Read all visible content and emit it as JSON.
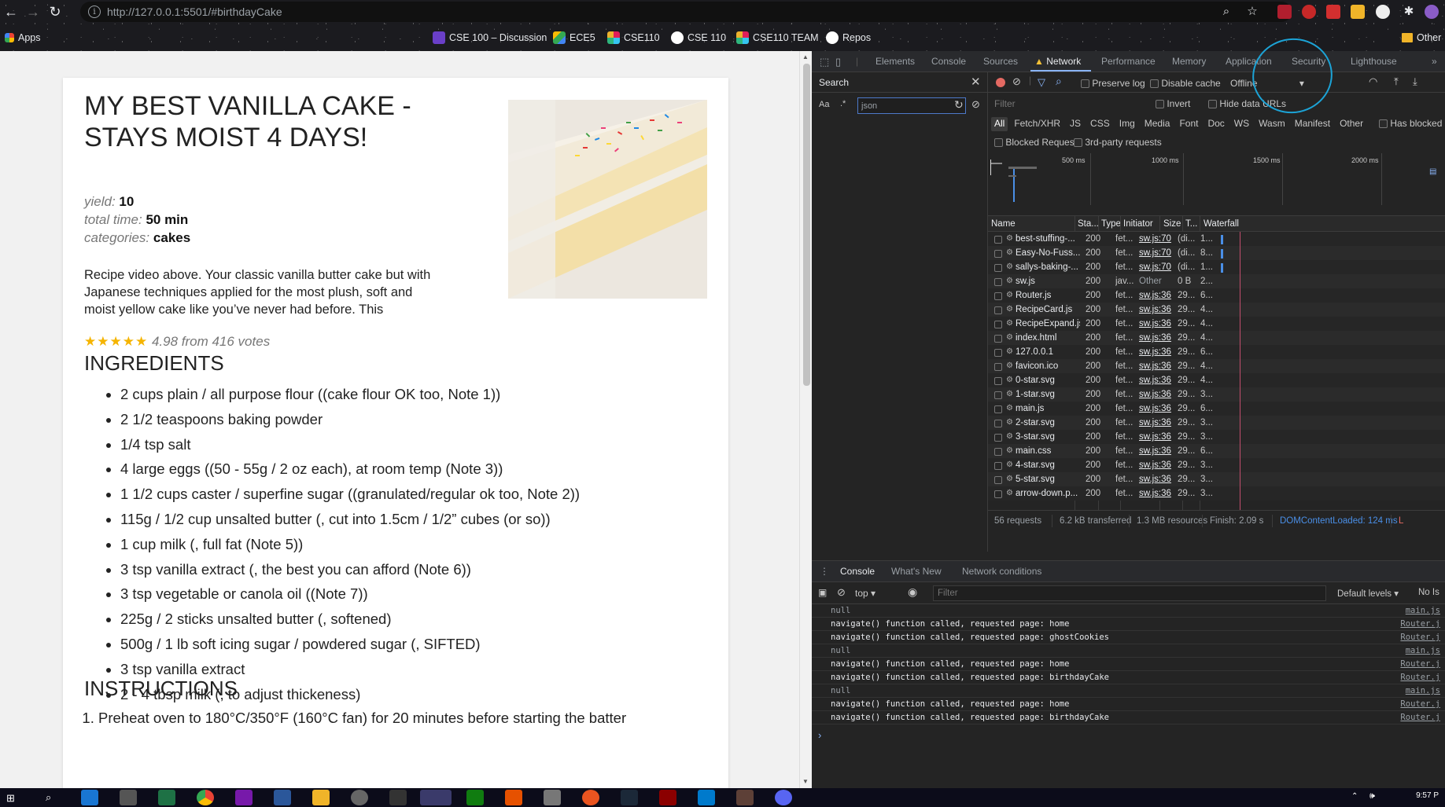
{
  "browser": {
    "url": "http://127.0.0.1:5501/#birthdayCake",
    "bookmarks": [
      "Apps",
      "CSE 100 – Discussion",
      "ECE5",
      "CSE110",
      "CSE 110",
      "CSE110 TEAM",
      "Repos",
      "Other"
    ]
  },
  "recipe": {
    "title": "MY BEST VANILLA CAKE - STAYS MOIST 4 DAYS!",
    "yield_label": "yield:",
    "yield_value": "10",
    "total_time_label": "total time:",
    "total_time_value": "50 min",
    "categories_label": "categories:",
    "categories_value": "cakes",
    "description": "Recipe video above. Your classic vanilla butter cake but with Japanese techniques applied for the most plush, soft and moist yellow cake like you’ve never had before. This",
    "stars": "★★★★★",
    "rating_text": "4.98 from 416 votes",
    "ingredients_title": "INGREDIENTS",
    "ingredients": [
      "2 cups plain / all purpose flour ((cake flour OK too, Note 1))",
      "2 1/2 teaspoons baking powder",
      "1/4 tsp salt",
      "4 large eggs ((50 - 55g / 2 oz each), at room temp (Note 3))",
      "1 1/2 cups caster / superfine sugar ((granulated/regular ok too, Note 2))",
      "115g / 1/2 cup unsalted butter (, cut into 1.5cm / 1/2” cubes (or so))",
      "1 cup milk (, full fat (Note 5))",
      "3 tsp vanilla extract (, the best you can afford (Note 6))",
      "3 tsp vegetable or canola oil ((Note 7))",
      "225g / 2 sticks unsalted butter (, softened)",
      "500g / 1 lb soft icing sugar / powdered sugar (, SIFTED)",
      "3 tsp vanilla extract",
      "2 - 4 tbsp milk (, to adjust thickeness)"
    ],
    "instructions_title": "INSTRUCTIONS",
    "first_instruction": "Preheat oven to 180°C/350°F (160°C fan) for 20 minutes before starting the batter"
  },
  "devtools": {
    "tabs": [
      "Elements",
      "Console",
      "Sources",
      "Network",
      "Performance",
      "Memory",
      "Application",
      "Security",
      "Lighthouse"
    ],
    "active_tab": "Network",
    "search_label": "Search",
    "search_value": "json",
    "search_case": "Aa",
    "search_regex": ".*",
    "preserve_log": "Preserve log",
    "disable_cache": "Disable cache",
    "throttling": "Offline",
    "filter_placeholder": "Filter",
    "invert": "Invert",
    "hide_data_urls": "Hide data URLs",
    "type_filters": [
      "All",
      "Fetch/XHR",
      "JS",
      "CSS",
      "Img",
      "Media",
      "Font",
      "Doc",
      "WS",
      "Wasm",
      "Manifest",
      "Other"
    ],
    "has_blocked_cookies": "Has blocked cookies",
    "blocked_requests": "Blocked Requests",
    "third_party": "3rd-party requests",
    "timeline_ticks": [
      "500 ms",
      "1000 ms",
      "1500 ms",
      "2000 ms"
    ],
    "columns": [
      "Name",
      "Sta...",
      "Type",
      "Initiator",
      "Size",
      "T...",
      "Waterfall"
    ],
    "requests": [
      {
        "name": "best-stuffing-...",
        "status": "200",
        "type": "fet...",
        "initiator": "sw.js:70",
        "size": "(di...",
        "time": "1..."
      },
      {
        "name": "Easy-No-Fuss...",
        "status": "200",
        "type": "fet...",
        "initiator": "sw.js:70",
        "size": "(di...",
        "time": "8..."
      },
      {
        "name": "sallys-baking-...",
        "status": "200",
        "type": "fet...",
        "initiator": "sw.js:70",
        "size": "(di...",
        "time": "1..."
      },
      {
        "name": "sw.js",
        "status": "200",
        "type": "jav...",
        "initiator": "Other",
        "size": "0 B",
        "time": "2..."
      },
      {
        "name": "Router.js",
        "status": "200",
        "type": "fet...",
        "initiator": "sw.js:36",
        "size": "29...",
        "time": "6..."
      },
      {
        "name": "RecipeCard.js",
        "status": "200",
        "type": "fet...",
        "initiator": "sw.js:36",
        "size": "29...",
        "time": "4..."
      },
      {
        "name": "RecipeExpand.js",
        "status": "200",
        "type": "fet...",
        "initiator": "sw.js:36",
        "size": "29...",
        "time": "4..."
      },
      {
        "name": "index.html",
        "status": "200",
        "type": "fet...",
        "initiator": "sw.js:36",
        "size": "29...",
        "time": "4..."
      },
      {
        "name": "127.0.0.1",
        "status": "200",
        "type": "fet...",
        "initiator": "sw.js:36",
        "size": "29...",
        "time": "6..."
      },
      {
        "name": "favicon.ico",
        "status": "200",
        "type": "fet...",
        "initiator": "sw.js:36",
        "size": "29...",
        "time": "4..."
      },
      {
        "name": "0-star.svg",
        "status": "200",
        "type": "fet...",
        "initiator": "sw.js:36",
        "size": "29...",
        "time": "4..."
      },
      {
        "name": "1-star.svg",
        "status": "200",
        "type": "fet...",
        "initiator": "sw.js:36",
        "size": "29...",
        "time": "3..."
      },
      {
        "name": "main.js",
        "status": "200",
        "type": "fet...",
        "initiator": "sw.js:36",
        "size": "29...",
        "time": "6..."
      },
      {
        "name": "2-star.svg",
        "status": "200",
        "type": "fet...",
        "initiator": "sw.js:36",
        "size": "29...",
        "time": "3..."
      },
      {
        "name": "3-star.svg",
        "status": "200",
        "type": "fet...",
        "initiator": "sw.js:36",
        "size": "29...",
        "time": "3..."
      },
      {
        "name": "main.css",
        "status": "200",
        "type": "fet...",
        "initiator": "sw.js:36",
        "size": "29...",
        "time": "6..."
      },
      {
        "name": "4-star.svg",
        "status": "200",
        "type": "fet...",
        "initiator": "sw.js:36",
        "size": "29...",
        "time": "3..."
      },
      {
        "name": "5-star.svg",
        "status": "200",
        "type": "fet...",
        "initiator": "sw.js:36",
        "size": "29...",
        "time": "3..."
      },
      {
        "name": "arrow-down.p...",
        "status": "200",
        "type": "fet...",
        "initiator": "sw.js:36",
        "size": "29...",
        "time": "3..."
      }
    ],
    "summary": {
      "requests": "56 requests",
      "transferred": "6.2 kB transferred",
      "resources": "1.3 MB resources",
      "finish": "Finish: 2.09 s",
      "dcl": "DOMContentLoaded: 124 ms",
      "load": "L"
    },
    "drawer_tabs": [
      "Console",
      "What's New",
      "Network conditions"
    ],
    "context": "top",
    "console_filter_placeholder": "Filter",
    "default_levels": "Default levels",
    "no_issues": "No Is",
    "console_lines": [
      {
        "msg": "null",
        "src": "main.js"
      },
      {
        "msg": "navigate() function called, requested page: home",
        "src": "Router.j"
      },
      {
        "msg": "navigate() function called, requested page: ghostCookies",
        "src": "Router.j"
      },
      {
        "msg": "null",
        "src": "main.js"
      },
      {
        "msg": "navigate() function called, requested page: home",
        "src": "Router.j"
      },
      {
        "msg": "navigate() function called, requested page: birthdayCake",
        "src": "Router.j"
      },
      {
        "msg": "null",
        "src": "main.js"
      },
      {
        "msg": "navigate() function called, requested page: home",
        "src": "Router.j"
      },
      {
        "msg": "navigate() function called, requested page: birthdayCake",
        "src": "Router.j"
      }
    ],
    "prompt_symbol": "›"
  },
  "taskbar": {
    "clock": "9:57 P"
  },
  "colors": {
    "accent": "#8ab4f8",
    "record_red": "#e46962",
    "annotation": "#1ca3d6",
    "star": "#f5b400"
  }
}
